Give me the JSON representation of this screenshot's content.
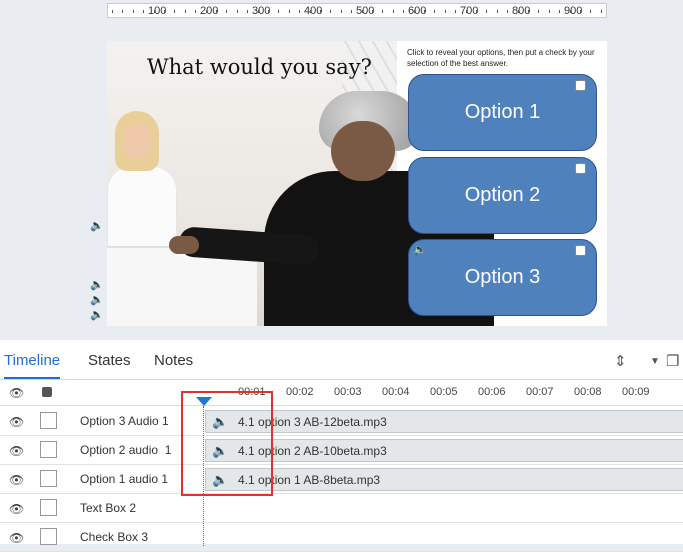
{
  "ruler": {
    "marks": [
      "100",
      "200",
      "300",
      "400",
      "500",
      "600",
      "700",
      "800",
      "900"
    ]
  },
  "slide": {
    "title": "What would you say?",
    "prompt": "Click to reveal your options, then put a check by your selection of the best answer.",
    "options": [
      "Option 1",
      "Option 2",
      "Option 3"
    ]
  },
  "timeline": {
    "tabs": [
      "Timeline",
      "States",
      "Notes"
    ],
    "times": [
      "00:01",
      "00:02",
      "00:03",
      "00:04",
      "00:05",
      "00:06",
      "00:07",
      "00:08",
      "00:09"
    ],
    "rows": [
      {
        "name": "Option 3 Audio 1",
        "clip": "4.1 option 3 AB-12beta.mp3"
      },
      {
        "name": "Option 2 audio  1",
        "clip": "4.1 option 2 AB-10beta.mp3"
      },
      {
        "name": "Option 1 audio 1",
        "clip": "4.1 option 1 AB-8beta.mp3"
      },
      {
        "name": "Text Box 2",
        "clip": ""
      },
      {
        "name": "Check Box 3",
        "clip": ""
      }
    ]
  },
  "colors": {
    "option_fill": "#4f81bd",
    "accent": "#1d6fd1",
    "highlight": "#e0322e"
  }
}
